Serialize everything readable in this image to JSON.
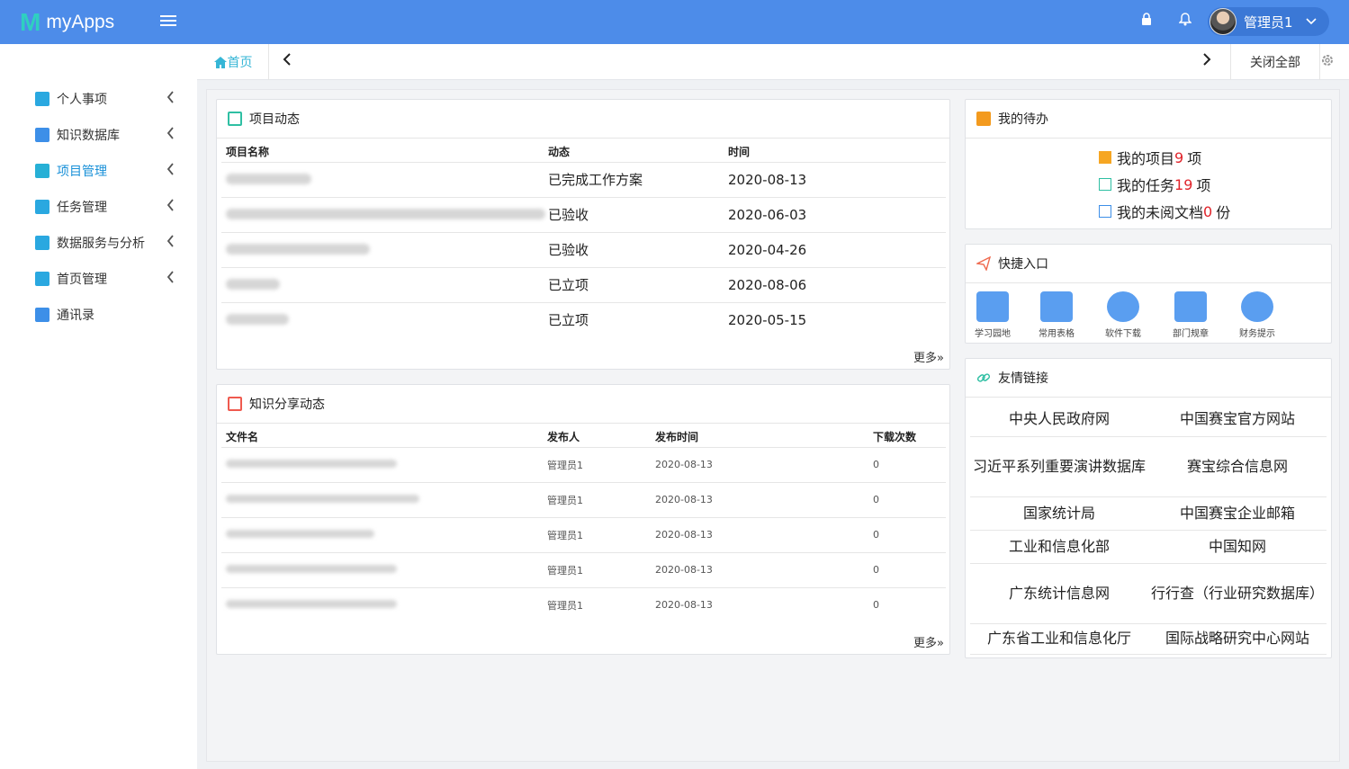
{
  "app": {
    "logo_mark": "M",
    "title": "myApps"
  },
  "header": {
    "user_name": "管理员1"
  },
  "sidebar": {
    "items": [
      {
        "label": "个人事项",
        "icon": "cube-icon",
        "color": "#2aa8e0",
        "arrow": true
      },
      {
        "label": "知识数据库",
        "icon": "document-icon",
        "color": "#3d8fe8",
        "arrow": true
      },
      {
        "label": "项目管理",
        "icon": "table-icon",
        "color": "#27b0d6",
        "arrow": true,
        "active": true
      },
      {
        "label": "任务管理",
        "icon": "cube-icon",
        "color": "#2aa8e0",
        "arrow": true
      },
      {
        "label": "数据服务与分析",
        "icon": "bar-chart-icon",
        "color": "#2aa8e0",
        "arrow": true
      },
      {
        "label": "首页管理",
        "icon": "cube-icon",
        "color": "#2aa8e0",
        "arrow": true
      },
      {
        "label": "通讯录",
        "icon": "document-icon",
        "color": "#3d8fe8",
        "arrow": false
      }
    ]
  },
  "tabs": {
    "home": "首页",
    "close_all": "关闭全部"
  },
  "project_panel": {
    "title": "项目动态",
    "columns": [
      "项目名称",
      "动态",
      "时间"
    ],
    "rows": [
      {
        "status": "已完成工作方案",
        "date": "2020-08-13"
      },
      {
        "status": "已验收",
        "date": "2020-06-03"
      },
      {
        "status": "已验收",
        "date": "2020-04-26"
      },
      {
        "status": "已立项",
        "date": "2020-08-06"
      },
      {
        "status": "已立项",
        "date": "2020-05-15"
      }
    ],
    "more": "更多»"
  },
  "knowledge_panel": {
    "title": "知识分享动态",
    "columns": [
      "文件名",
      "发布人",
      "发布时间",
      "下载次数"
    ],
    "rows": [
      {
        "publisher": "管理员1",
        "date": "2020-08-13",
        "downloads": "0"
      },
      {
        "publisher": "管理员1",
        "date": "2020-08-13",
        "downloads": "0"
      },
      {
        "publisher": "管理员1",
        "date": "2020-08-13",
        "downloads": "0"
      },
      {
        "publisher": "管理员1",
        "date": "2020-08-13",
        "downloads": "0"
      },
      {
        "publisher": "管理员1",
        "date": "2020-08-13",
        "downloads": "0"
      }
    ],
    "more": "更多»"
  },
  "todo_panel": {
    "title": "我的待办",
    "items": [
      {
        "prefix": "我的项目",
        "count": "9",
        "suffix": "项"
      },
      {
        "prefix": "我的任务",
        "count": "19",
        "suffix": "项"
      },
      {
        "prefix": "我的未阅文档",
        "count": "0",
        "suffix": "份"
      }
    ]
  },
  "quick_panel": {
    "title": "快捷入口",
    "items": [
      {
        "label": "学习园地",
        "icon": "study-icon"
      },
      {
        "label": "常用表格",
        "icon": "form-icon"
      },
      {
        "label": "软件下载",
        "icon": "rocket-icon"
      },
      {
        "label": "部门规章",
        "icon": "stamp-icon"
      },
      {
        "label": "财务提示",
        "icon": "yuan-icon"
      }
    ]
  },
  "links_panel": {
    "title": "友情链接",
    "rows": [
      [
        "中央人民政府网",
        "中国赛宝官方网站"
      ],
      [
        "习近平系列重要演讲数据库",
        "赛宝综合信息网"
      ],
      [
        "国家统计局",
        "中国赛宝企业邮箱"
      ],
      [
        "工业和信息化部",
        "中国知网"
      ],
      [
        "广东统计信息网",
        "行行查（行业研究数据库）"
      ],
      [
        "广东省工业和信息化厅",
        "国际战略研究中心网站"
      ]
    ]
  },
  "colors": {
    "header": "#4d8ce9",
    "accent": "#1890d8",
    "count": "#e0232a"
  }
}
